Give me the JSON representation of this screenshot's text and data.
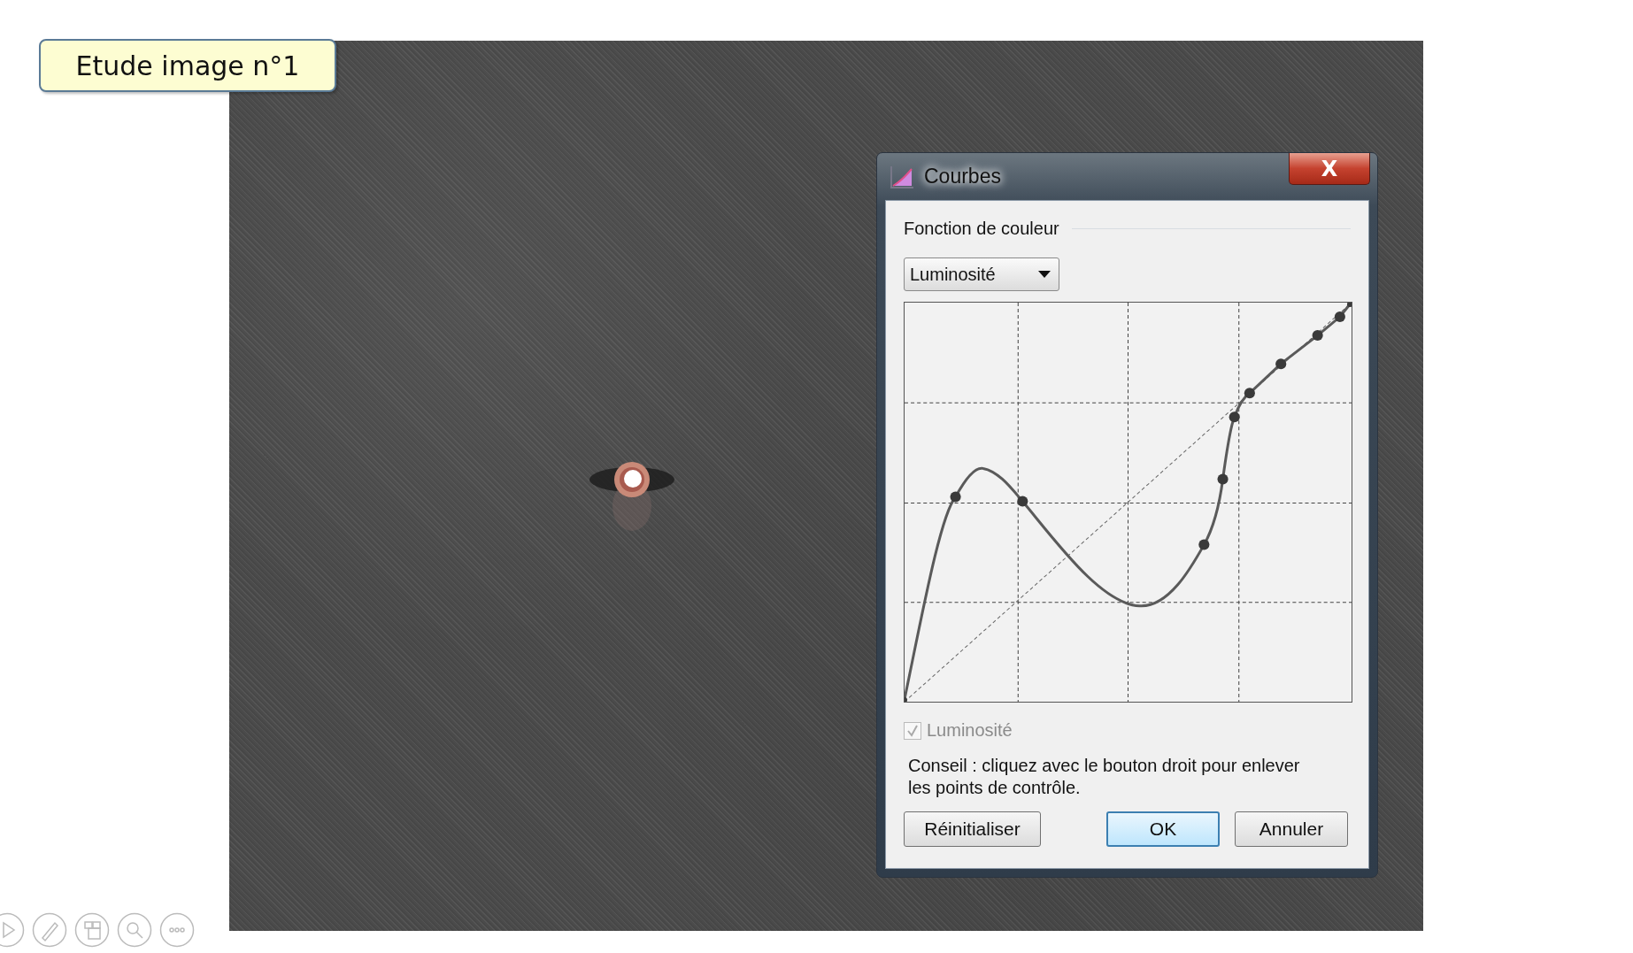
{
  "slide": {
    "title": "Etude image n°1"
  },
  "dialog": {
    "title": "Courbes",
    "close_glyph": "X",
    "group_label": "Fonction de couleur",
    "channel_select": {
      "value": "Luminosité"
    },
    "channel_checkbox": {
      "label": "Luminosité",
      "checked": true,
      "disabled": true
    },
    "hint": "Conseil : cliquez avec le bouton droit pour enlever\nles points de contrôle.",
    "buttons": [
      {
        "label": "Réinitialiser",
        "default": false
      },
      {
        "label": "OK",
        "default": true
      },
      {
        "label": "Annuler",
        "default": false
      }
    ]
  }
}
